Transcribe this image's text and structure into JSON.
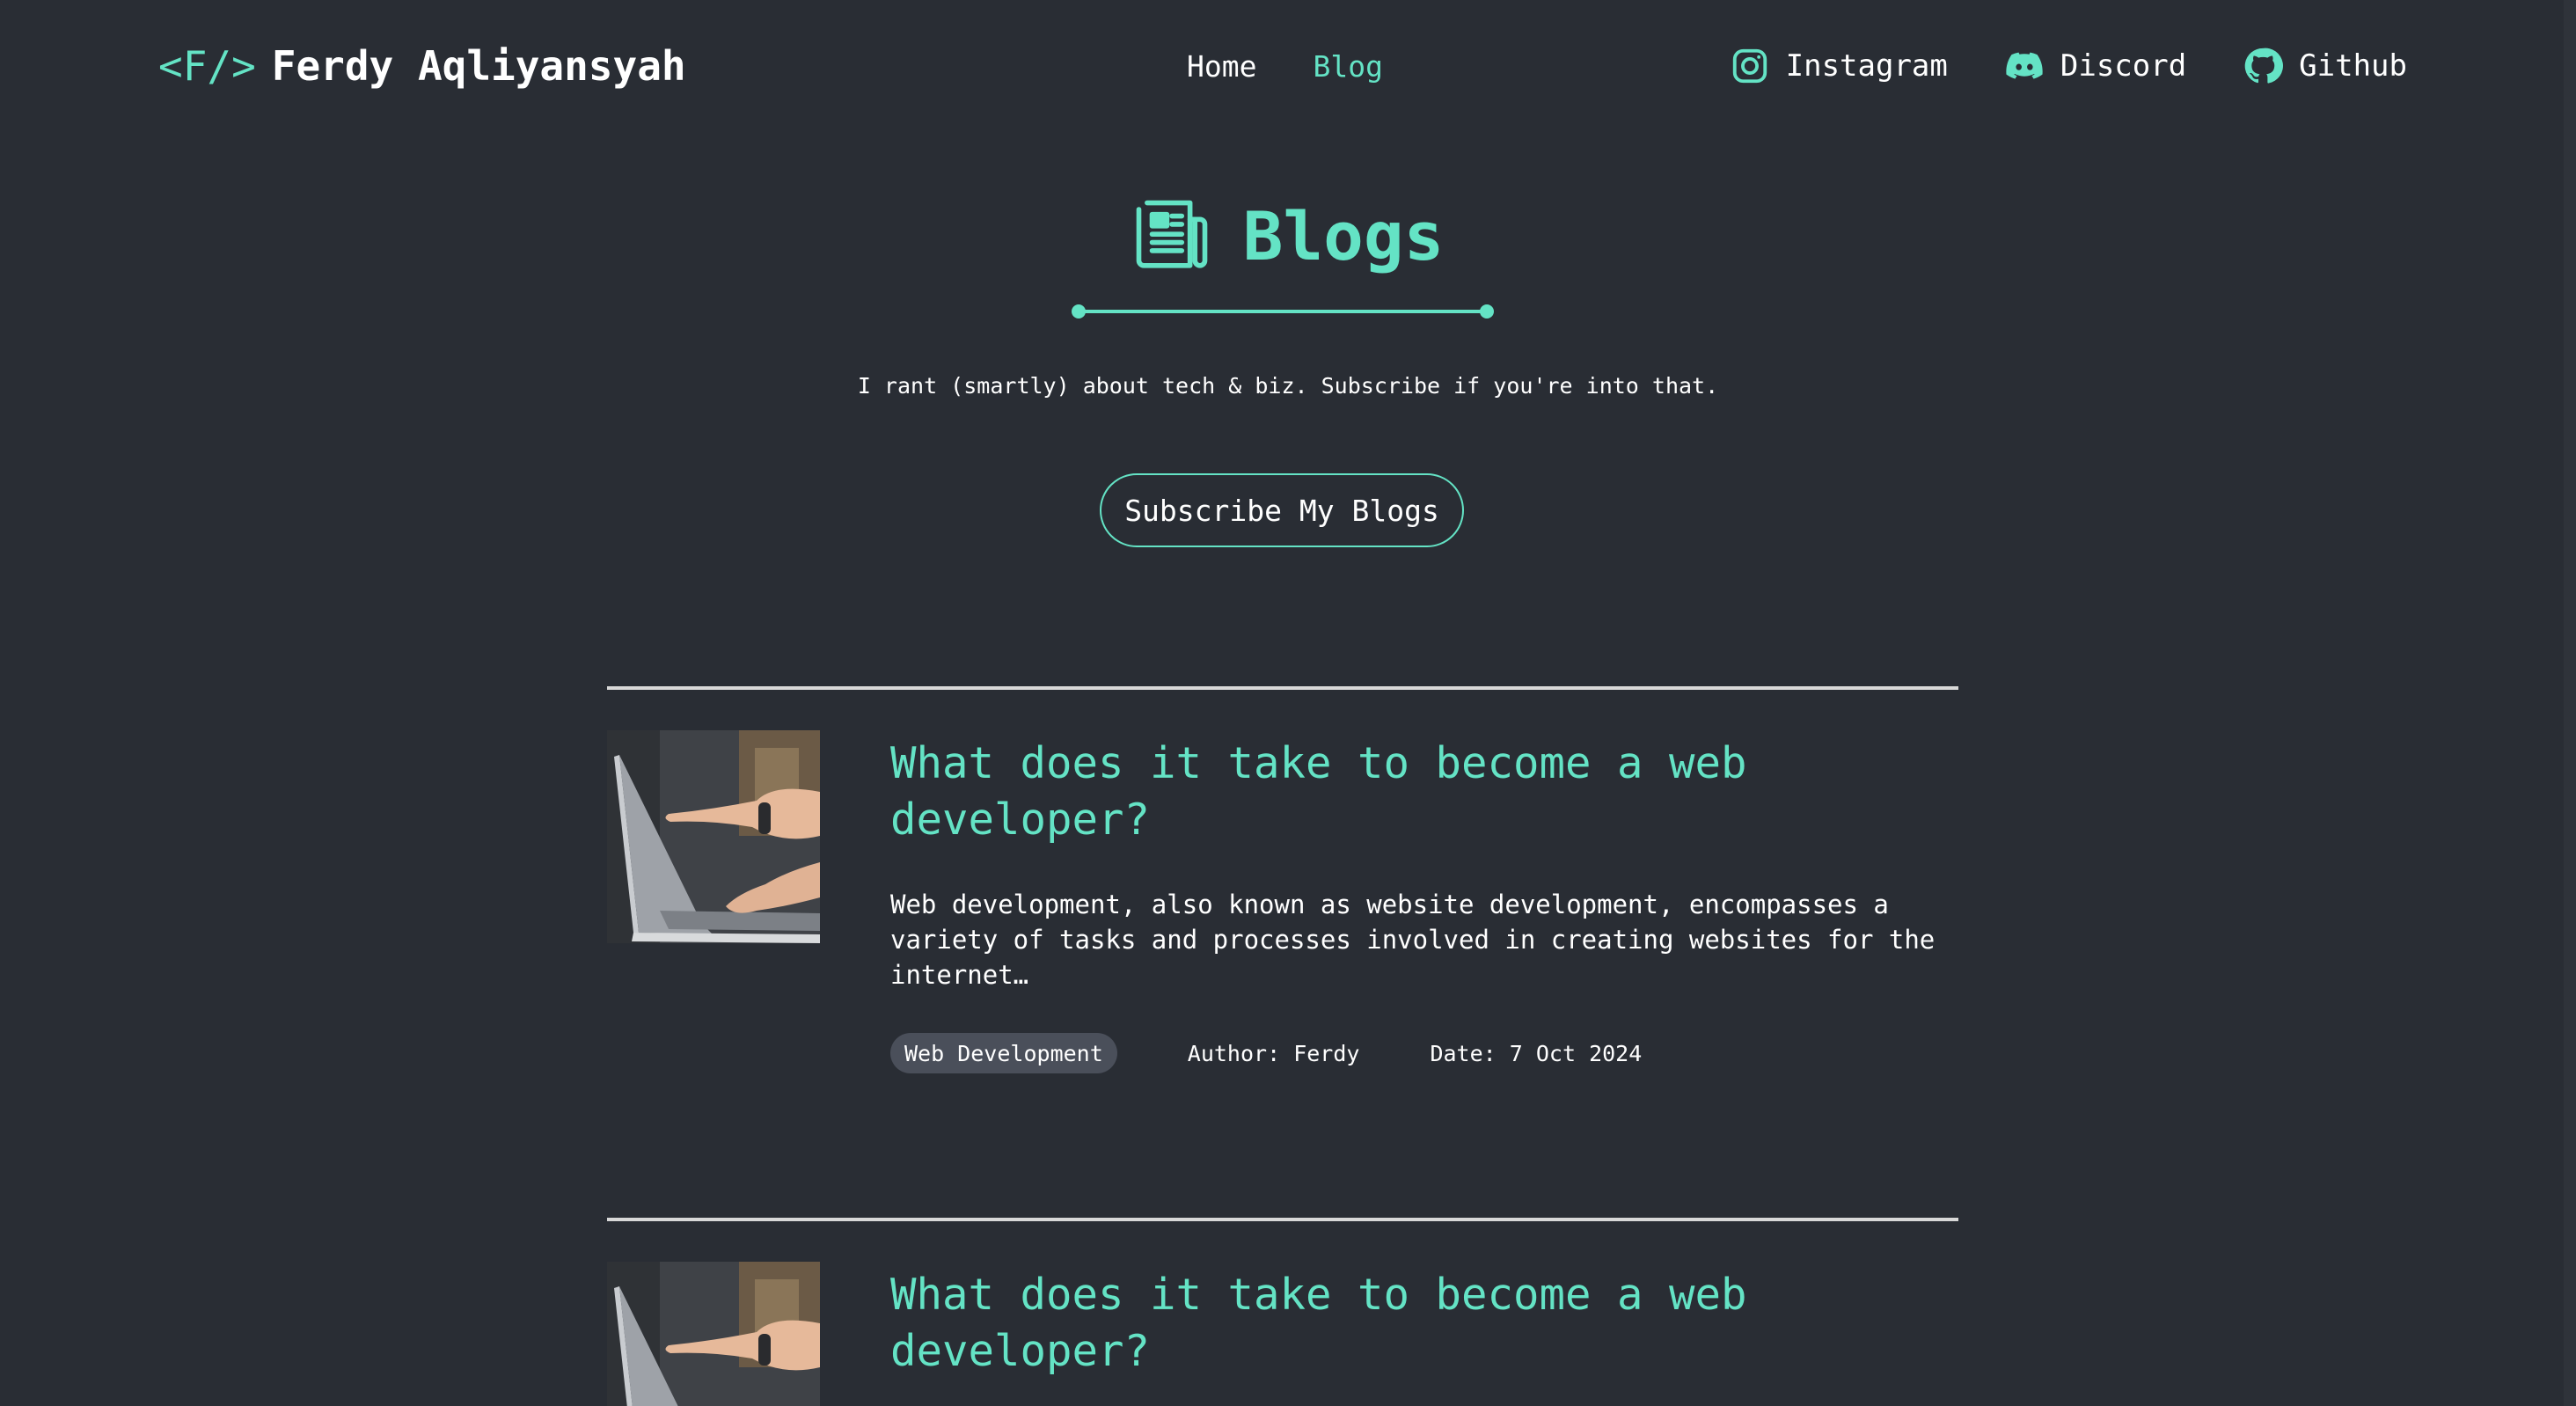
{
  "header": {
    "brand_code": "<F/>",
    "brand_name": "Ferdy Aqliyansyah",
    "nav": [
      {
        "label": "Home",
        "active": false
      },
      {
        "label": "Blog",
        "active": true
      }
    ],
    "socials": [
      {
        "label": "Instagram",
        "icon": "instagram-icon"
      },
      {
        "label": "Discord",
        "icon": "discord-icon"
      },
      {
        "label": "Github",
        "icon": "github-icon"
      }
    ]
  },
  "hero": {
    "icon": "newspaper-icon",
    "title": "Blogs",
    "tagline": "I rant (smartly) about tech & biz. Subscribe if you're into that.",
    "subscribe_label": "Subscribe My Blogs"
  },
  "posts": [
    {
      "title": "What does it take to become a web developer?",
      "excerpt": "Web development, also known as website development, encompasses a variety of tasks and processes involved in creating websites for the internet…",
      "tag": "Web Development",
      "author": "Author: Ferdy",
      "date": "Date: 7 Oct 2024"
    },
    {
      "title": "What does it take to become a web developer?"
    }
  ],
  "colors": {
    "background": "#292d34",
    "accent": "#64e3c5",
    "tag_bg": "#4a4f5a"
  }
}
